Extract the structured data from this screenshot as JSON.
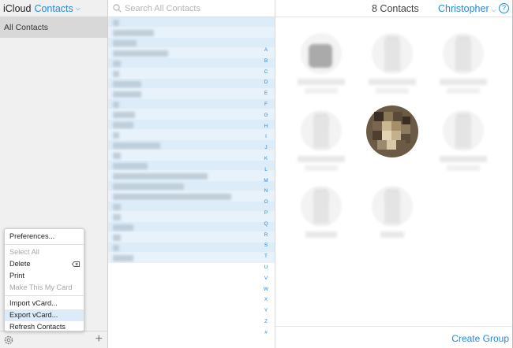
{
  "sidebar": {
    "brand": "iCloud",
    "app": "Contacts",
    "group": "All Contacts"
  },
  "menu": {
    "items": [
      {
        "label": "Preferences...",
        "enabled": true
      },
      {
        "label": "Select All",
        "enabled": false
      },
      {
        "label": "Delete",
        "enabled": true
      },
      {
        "label": "Print",
        "enabled": true
      },
      {
        "label": "Make This My Card",
        "enabled": false
      },
      {
        "label": "Import vCard...",
        "enabled": true
      },
      {
        "label": "Export vCard...",
        "enabled": true,
        "highlighted": true
      },
      {
        "label": "Refresh Contacts",
        "enabled": true
      }
    ]
  },
  "list": {
    "search_placeholder": "Search All Contacts",
    "index_letters": [
      "A",
      "B",
      "C",
      "D",
      "E",
      "F",
      "G",
      "H",
      "I",
      "J",
      "K",
      "L",
      "M",
      "N",
      "O",
      "P",
      "Q",
      "R",
      "S",
      "T",
      "U",
      "V",
      "W",
      "X",
      "Y",
      "Z",
      "#"
    ]
  },
  "main": {
    "count": "8 Contacts",
    "user": "Christopher",
    "help": "?",
    "create_group": "Create Group"
  },
  "colors": {
    "accent": "#2a88d8",
    "selection": "#dcecf8",
    "sidebar_bg": "#f0f0f0"
  }
}
